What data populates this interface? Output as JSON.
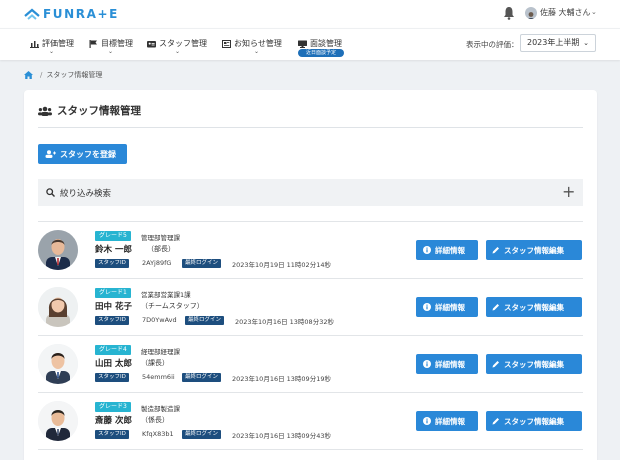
{
  "app": {
    "brand": "FUNRA+E",
    "user_name": "佐藤 大輔さん",
    "colors": {
      "brand": "#2a8fd6",
      "button": "#2a88d8",
      "grade_badge": "#27b4d1",
      "tag": "#1d4e7e"
    }
  },
  "nav": {
    "items": [
      {
        "label": "評価管理",
        "icon": "chart-icon"
      },
      {
        "label": "目標管理",
        "icon": "flag-icon"
      },
      {
        "label": "スタッフ管理",
        "icon": "id-card-icon"
      },
      {
        "label": "お知らせ管理",
        "icon": "news-icon"
      },
      {
        "label": "面談管理",
        "icon": "monitor-icon"
      }
    ],
    "interview_badge": "近日面談予定",
    "period_label": "表示中の評価：",
    "period_value": "2023年上半期"
  },
  "breadcrumb": {
    "current": "スタッフ情報管理"
  },
  "page": {
    "title": "スタッフ情報管理",
    "register_button": "スタッフを登録",
    "filter_label": "絞り込み検索",
    "detail_button": "詳細情報",
    "edit_button": "スタッフ情報編集",
    "staff_id_tag": "スタッフID",
    "last_login_tag": "最終ログイン"
  },
  "staff": [
    {
      "grade": "グレード5",
      "dept": "管理部管理課",
      "name": "鈴木 一郎",
      "role": "（部長）",
      "staff_id": "2AYj89fG",
      "last_login": "2023年10月19日 11時02分14秒"
    },
    {
      "grade": "グレード1",
      "dept": "営業部営業課1課",
      "name": "田中 花子",
      "role": "（チームスタッフ）",
      "staff_id": "7D0YwAvd",
      "last_login": "2023年10月16日 13時08分32秒"
    },
    {
      "grade": "グレード4",
      "dept": "経理部経理課",
      "name": "山田 太郎",
      "role": "（課長）",
      "staff_id": "54emm6ii",
      "last_login": "2023年10月16日 13時09分19秒"
    },
    {
      "grade": "グレード3",
      "dept": "製造部製造課",
      "name": "斎藤 次郎",
      "role": "（係長）",
      "staff_id": "KfqX83b1",
      "last_login": "2023年10月16日 13時09分43秒"
    }
  ]
}
